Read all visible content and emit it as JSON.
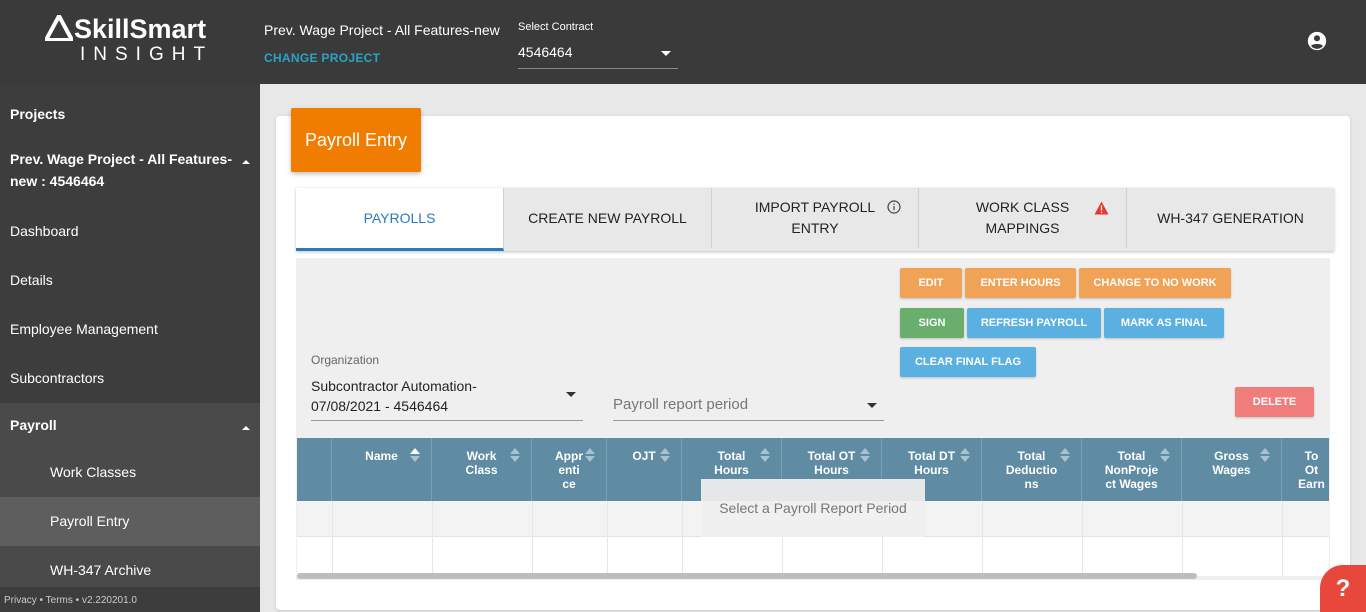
{
  "header": {
    "logo_main": "SkillSmart",
    "logo_sub": "INSIGHT",
    "project_name": "Prev. Wage Project - All Features-new",
    "change_project": "CHANGE PROJECT",
    "contract_label": "Select Contract",
    "contract_value": "4546464",
    "account_icon": "account-circle-icon"
  },
  "sidebar": {
    "projects": "Projects",
    "project_line1": "Prev. Wage Project - All Features-",
    "project_line2": "new : 4546464",
    "dashboard": "Dashboard",
    "details": "Details",
    "employee_management": "Employee Management",
    "subcontractors": "Subcontractors",
    "payroll": "Payroll",
    "work_classes": "Work Classes",
    "payroll_entry": "Payroll Entry",
    "wh347_archive": "WH-347 Archive",
    "footer": "Privacy • Terms • v2.220201.0"
  },
  "page": {
    "title": "Payroll Entry",
    "tabs": {
      "payrolls": "PAYROLLS",
      "create_new": "CREATE NEW PAYROLL",
      "import_line1": "IMPORT PAYROLL",
      "import_line2": "ENTRY",
      "work_class_line1": "WORK CLASS",
      "work_class_line2": "MAPPINGS",
      "wh347": "WH-347 GENERATION"
    },
    "buttons": {
      "edit": "EDIT",
      "enter_hours": "ENTER HOURS",
      "change_no_work": "CHANGE TO NO WORK",
      "sign": "SIGN",
      "refresh": "REFRESH PAYROLL",
      "mark_final": "MARK AS FINAL",
      "clear_final": "CLEAR FINAL FLAG",
      "delete": "DELETE"
    },
    "organization_label": "Organization",
    "organization_value_line1": "Subcontractor Automation-",
    "organization_value_line2": "07/08/2021 - 4546464",
    "period_placeholder": "Payroll report period",
    "table": {
      "columns": [
        {
          "l1": "Name",
          "l2": "",
          "l3": ""
        },
        {
          "l1": "Work",
          "l2": "Class",
          "l3": ""
        },
        {
          "l1": "Appr",
          "l2": "enti",
          "l3": "ce"
        },
        {
          "l1": "OJT",
          "l2": "",
          "l3": ""
        },
        {
          "l1": "Total",
          "l2": "Hours",
          "l3": ""
        },
        {
          "l1": "Total OT",
          "l2": "Hours",
          "l3": ""
        },
        {
          "l1": "Total DT",
          "l2": "Hours",
          "l3": ""
        },
        {
          "l1": "Total",
          "l2": "Deductio",
          "l3": "ns"
        },
        {
          "l1": "Total",
          "l2": "NonProje",
          "l3": "ct Wages"
        },
        {
          "l1": "Gross",
          "l2": "Wages",
          "l3": ""
        },
        {
          "l1": "To",
          "l2": "Ot",
          "l3": "Earn"
        }
      ],
      "empty_message": "Select a Payroll Report Period"
    },
    "help": "?"
  },
  "colors": {
    "accent_orange": "#f07c00",
    "tab_active": "#2a7bbd",
    "table_header": "#5f8ba3",
    "link": "#2aa3c4"
  }
}
